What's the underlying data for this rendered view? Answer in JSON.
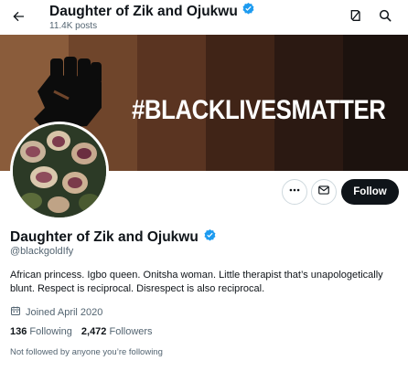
{
  "header": {
    "title": "Daughter of Zik and Ojukwu",
    "posts": "11.4K posts"
  },
  "banner": {
    "hashtag": "#BLACKLIVESMATTER",
    "stripe_colors": [
      "#885b3a",
      "#6e442a",
      "#5a3421",
      "#3f2417",
      "#2a1912",
      "#1b110d"
    ]
  },
  "actions": {
    "follow_label": "Follow"
  },
  "profile": {
    "name": "Daughter of Zik and Ojukwu",
    "handle": "@blackgoldIfy",
    "bio": "African princess. Igbo queen. Onitsha woman. Little therapist that’s unapologetically blunt. Respect is reciprocal. Disrespect is also reciprocal.",
    "joined": "Joined April 2020",
    "following_count": "136",
    "following_label": "Following",
    "followers_count": "2,472",
    "followers_label": "Followers",
    "not_followed": "Not followed by anyone you’re following"
  },
  "colors": {
    "verified": "#1d9bf0",
    "text_secondary": "#536471",
    "follow_bg": "#0f1419"
  }
}
